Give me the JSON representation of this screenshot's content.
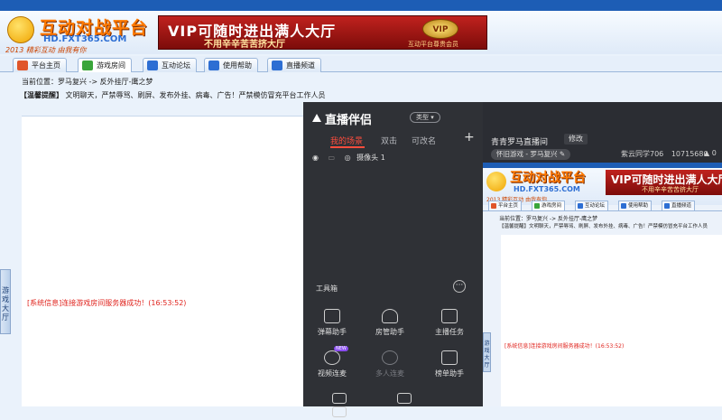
{
  "platform": {
    "logo_text": "互动对战平台",
    "logo_url": "HD.FXT365.COM",
    "logo_slogan": "2013 精彩互动 由我有你",
    "vip_banner": {
      "main": "VIP可随时进出满人大厅",
      "sub": "不用辛辛苦苦挤大厅",
      "emblem": "VIP",
      "caption": "互动平台尊贵会员"
    },
    "tabs": [
      {
        "label": "平台主页",
        "icon": "home-icon",
        "color": "#e0552a"
      },
      {
        "label": "游戏房间",
        "icon": "gamepad-icon",
        "color": "#3aa53a"
      },
      {
        "label": "互动论坛",
        "icon": "forum-icon",
        "color": "#2d6ed3"
      },
      {
        "label": "使用帮助",
        "icon": "help-icon",
        "color": "#2d6ed3"
      },
      {
        "label": "直播频道",
        "icon": "broadcast-icon",
        "color": "#2d6ed3"
      }
    ],
    "breadcrumb": "当前位置：罗马复兴 -> 反外挂厅-鹰之梦",
    "notice_label": "【温馨提醒】",
    "notice_text": "文明聊天，严禁辱骂、刷屏、发布外挂、病毒、广告！严禁模仿冒充平台工作人员",
    "system_message": "[系统信息]连接游戏房间服务器成功！(16:53:52)",
    "side_handle": "游戏大厅"
  },
  "stream_app": {
    "title": "直播伴侣",
    "type_button": "类型",
    "tabs": [
      "我的场景",
      "双击",
      "可改名"
    ],
    "active_tab": 0,
    "add_symbol": "+",
    "source_item": "摄像头 1",
    "toolbox_title": "工具箱",
    "more_symbol": "···",
    "tools": [
      {
        "label": "弹幕助手",
        "icon": "danmaku-icon",
        "enabled": true
      },
      {
        "label": "房管助手",
        "icon": "admin-icon",
        "enabled": true
      },
      {
        "label": "主播任务",
        "icon": "task-icon",
        "enabled": true
      },
      {
        "label": "视频连麦",
        "icon": "video-link-icon",
        "enabled": true,
        "badge": "NEW"
      },
      {
        "label": "多人连麦",
        "icon": "multi-link-icon",
        "enabled": false
      },
      {
        "label": "榜单助手",
        "icon": "ranking-icon",
        "enabled": true
      }
    ],
    "room_title": "青青罗马直播间",
    "edit_button": "修改",
    "category_chip": "怀旧游戏 - 罗马复兴",
    "user_name": "紫云同学706",
    "room_id": "10715680",
    "viewers": "0",
    "accent_color": "#ff4d3d"
  }
}
